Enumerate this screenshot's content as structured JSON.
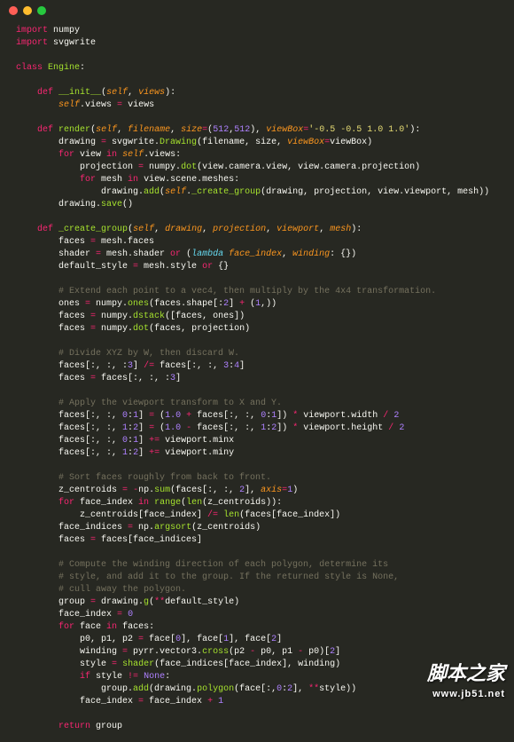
{
  "watermark": {
    "text": "脚本之家",
    "url": "www.jb51.net"
  },
  "code_lines": [
    [
      [
        "kw",
        "import"
      ],
      [
        "nm",
        " numpy"
      ]
    ],
    [
      [
        "kw",
        "import"
      ],
      [
        "nm",
        " svgwrite"
      ]
    ],
    [],
    [
      [
        "kw",
        "class"
      ],
      [
        "nm",
        " "
      ],
      [
        "cls",
        "Engine"
      ],
      [
        "nm",
        ":"
      ]
    ],
    [],
    [
      [
        "nm",
        "    "
      ],
      [
        "kw",
        "def"
      ],
      [
        "nm",
        " "
      ],
      [
        "fn",
        "__init__"
      ],
      [
        "nm",
        "("
      ],
      [
        "slf",
        "self"
      ],
      [
        "nm",
        ", "
      ],
      [
        "par",
        "views"
      ],
      [
        "nm",
        "):"
      ]
    ],
    [
      [
        "nm",
        "        "
      ],
      [
        "slf",
        "self"
      ],
      [
        "nm",
        ".views "
      ],
      [
        "op",
        "="
      ],
      [
        "nm",
        " views"
      ]
    ],
    [],
    [
      [
        "nm",
        "    "
      ],
      [
        "kw",
        "def"
      ],
      [
        "nm",
        " "
      ],
      [
        "fn",
        "render"
      ],
      [
        "nm",
        "("
      ],
      [
        "slf",
        "self"
      ],
      [
        "nm",
        ", "
      ],
      [
        "par",
        "filename"
      ],
      [
        "nm",
        ", "
      ],
      [
        "par",
        "size"
      ],
      [
        "op",
        "="
      ],
      [
        "nm",
        "("
      ],
      [
        "num",
        "512"
      ],
      [
        "nm",
        ","
      ],
      [
        "num",
        "512"
      ],
      [
        "nm",
        "), "
      ],
      [
        "par",
        "viewBox"
      ],
      [
        "op",
        "="
      ],
      [
        "str",
        "'-0.5 -0.5 1.0 1.0'"
      ],
      [
        "nm",
        "):"
      ]
    ],
    [
      [
        "nm",
        "        drawing "
      ],
      [
        "op",
        "="
      ],
      [
        "nm",
        " svgwrite."
      ],
      [
        "fn",
        "Drawing"
      ],
      [
        "nm",
        "(filename, size, "
      ],
      [
        "par",
        "viewBox"
      ],
      [
        "op",
        "="
      ],
      [
        "nm",
        "viewBox)"
      ]
    ],
    [
      [
        "nm",
        "        "
      ],
      [
        "kw",
        "for"
      ],
      [
        "nm",
        " view "
      ],
      [
        "kw",
        "in"
      ],
      [
        "nm",
        " "
      ],
      [
        "slf",
        "self"
      ],
      [
        "nm",
        ".views:"
      ]
    ],
    [
      [
        "nm",
        "            projection "
      ],
      [
        "op",
        "="
      ],
      [
        "nm",
        " numpy."
      ],
      [
        "fn",
        "dot"
      ],
      [
        "nm",
        "(view.camera.view, view.camera.projection)"
      ]
    ],
    [
      [
        "nm",
        "            "
      ],
      [
        "kw",
        "for"
      ],
      [
        "nm",
        " mesh "
      ],
      [
        "kw",
        "in"
      ],
      [
        "nm",
        " view.scene.meshes:"
      ]
    ],
    [
      [
        "nm",
        "                drawing."
      ],
      [
        "fn",
        "add"
      ],
      [
        "nm",
        "("
      ],
      [
        "slf",
        "self"
      ],
      [
        "nm",
        "."
      ],
      [
        "fn",
        "_create_group"
      ],
      [
        "nm",
        "(drawing, projection, view.viewport, mesh))"
      ]
    ],
    [
      [
        "nm",
        "        drawing."
      ],
      [
        "fn",
        "save"
      ],
      [
        "nm",
        "()"
      ]
    ],
    [],
    [
      [
        "nm",
        "    "
      ],
      [
        "kw",
        "def"
      ],
      [
        "nm",
        " "
      ],
      [
        "fn",
        "_create_group"
      ],
      [
        "nm",
        "("
      ],
      [
        "slf",
        "self"
      ],
      [
        "nm",
        ", "
      ],
      [
        "par",
        "drawing"
      ],
      [
        "nm",
        ", "
      ],
      [
        "par",
        "projection"
      ],
      [
        "nm",
        ", "
      ],
      [
        "par",
        "viewport"
      ],
      [
        "nm",
        ", "
      ],
      [
        "par",
        "mesh"
      ],
      [
        "nm",
        "):"
      ]
    ],
    [
      [
        "nm",
        "        faces "
      ],
      [
        "op",
        "="
      ],
      [
        "nm",
        " mesh.faces"
      ]
    ],
    [
      [
        "nm",
        "        shader "
      ],
      [
        "op",
        "="
      ],
      [
        "nm",
        " mesh.shader "
      ],
      [
        "kw",
        "or"
      ],
      [
        "nm",
        " ("
      ],
      [
        "kw2",
        "lambda"
      ],
      [
        "nm",
        " "
      ],
      [
        "par",
        "face_index"
      ],
      [
        "nm",
        ", "
      ],
      [
        "par",
        "winding"
      ],
      [
        "nm",
        ": {})"
      ]
    ],
    [
      [
        "nm",
        "        default_style "
      ],
      [
        "op",
        "="
      ],
      [
        "nm",
        " mesh.style "
      ],
      [
        "kw",
        "or"
      ],
      [
        "nm",
        " {}"
      ]
    ],
    [],
    [
      [
        "nm",
        "        "
      ],
      [
        "cm",
        "# Extend each point to a vec4, then multiply by the 4x4 transformation."
      ]
    ],
    [
      [
        "nm",
        "        ones "
      ],
      [
        "op",
        "="
      ],
      [
        "nm",
        " numpy."
      ],
      [
        "fn",
        "ones"
      ],
      [
        "nm",
        "(faces.shape[:"
      ],
      [
        "num",
        "2"
      ],
      [
        "nm",
        "] "
      ],
      [
        "op",
        "+"
      ],
      [
        "nm",
        " ("
      ],
      [
        "num",
        "1"
      ],
      [
        "nm",
        ",))"
      ]
    ],
    [
      [
        "nm",
        "        faces "
      ],
      [
        "op",
        "="
      ],
      [
        "nm",
        " numpy."
      ],
      [
        "fn",
        "dstack"
      ],
      [
        "nm",
        "([faces, ones])"
      ]
    ],
    [
      [
        "nm",
        "        faces "
      ],
      [
        "op",
        "="
      ],
      [
        "nm",
        " numpy."
      ],
      [
        "fn",
        "dot"
      ],
      [
        "nm",
        "(faces, projection)"
      ]
    ],
    [],
    [
      [
        "nm",
        "        "
      ],
      [
        "cm",
        "# Divide XYZ by W, then discard W."
      ]
    ],
    [
      [
        "nm",
        "        faces[:, :, :"
      ],
      [
        "num",
        "3"
      ],
      [
        "nm",
        "] "
      ],
      [
        "op",
        "/="
      ],
      [
        "nm",
        " faces[:, :, "
      ],
      [
        "num",
        "3"
      ],
      [
        "nm",
        ":"
      ],
      [
        "num",
        "4"
      ],
      [
        "nm",
        "]"
      ]
    ],
    [
      [
        "nm",
        "        faces "
      ],
      [
        "op",
        "="
      ],
      [
        "nm",
        " faces[:, :, :"
      ],
      [
        "num",
        "3"
      ],
      [
        "nm",
        "]"
      ]
    ],
    [],
    [
      [
        "nm",
        "        "
      ],
      [
        "cm",
        "# Apply the viewport transform to X and Y."
      ]
    ],
    [
      [
        "nm",
        "        faces[:, :, "
      ],
      [
        "num",
        "0"
      ],
      [
        "nm",
        ":"
      ],
      [
        "num",
        "1"
      ],
      [
        "nm",
        "] "
      ],
      [
        "op",
        "="
      ],
      [
        "nm",
        " ("
      ],
      [
        "num",
        "1.0"
      ],
      [
        "nm",
        " "
      ],
      [
        "op",
        "+"
      ],
      [
        "nm",
        " faces[:, :, "
      ],
      [
        "num",
        "0"
      ],
      [
        "nm",
        ":"
      ],
      [
        "num",
        "1"
      ],
      [
        "nm",
        "]) "
      ],
      [
        "op",
        "*"
      ],
      [
        "nm",
        " viewport.width "
      ],
      [
        "op",
        "/"
      ],
      [
        "nm",
        " "
      ],
      [
        "num",
        "2"
      ]
    ],
    [
      [
        "nm",
        "        faces[:, :, "
      ],
      [
        "num",
        "1"
      ],
      [
        "nm",
        ":"
      ],
      [
        "num",
        "2"
      ],
      [
        "nm",
        "] "
      ],
      [
        "op",
        "="
      ],
      [
        "nm",
        " ("
      ],
      [
        "num",
        "1.0"
      ],
      [
        "nm",
        " "
      ],
      [
        "op",
        "-"
      ],
      [
        "nm",
        " faces[:, :, "
      ],
      [
        "num",
        "1"
      ],
      [
        "nm",
        ":"
      ],
      [
        "num",
        "2"
      ],
      [
        "nm",
        "]) "
      ],
      [
        "op",
        "*"
      ],
      [
        "nm",
        " viewport.height "
      ],
      [
        "op",
        "/"
      ],
      [
        "nm",
        " "
      ],
      [
        "num",
        "2"
      ]
    ],
    [
      [
        "nm",
        "        faces[:, :, "
      ],
      [
        "num",
        "0"
      ],
      [
        "nm",
        ":"
      ],
      [
        "num",
        "1"
      ],
      [
        "nm",
        "] "
      ],
      [
        "op",
        "+="
      ],
      [
        "nm",
        " viewport.minx"
      ]
    ],
    [
      [
        "nm",
        "        faces[:, :, "
      ],
      [
        "num",
        "1"
      ],
      [
        "nm",
        ":"
      ],
      [
        "num",
        "2"
      ],
      [
        "nm",
        "] "
      ],
      [
        "op",
        "+="
      ],
      [
        "nm",
        " viewport.miny"
      ]
    ],
    [],
    [
      [
        "nm",
        "        "
      ],
      [
        "cm",
        "# Sort faces roughly from back to front."
      ]
    ],
    [
      [
        "nm",
        "        z_centroids "
      ],
      [
        "op",
        "="
      ],
      [
        "nm",
        " "
      ],
      [
        "op",
        "-"
      ],
      [
        "nm",
        "np."
      ],
      [
        "fn",
        "sum"
      ],
      [
        "nm",
        "(faces[:, :, "
      ],
      [
        "num",
        "2"
      ],
      [
        "nm",
        "], "
      ],
      [
        "par",
        "axis"
      ],
      [
        "op",
        "="
      ],
      [
        "num",
        "1"
      ],
      [
        "nm",
        ")"
      ]
    ],
    [
      [
        "nm",
        "        "
      ],
      [
        "kw",
        "for"
      ],
      [
        "nm",
        " face_index "
      ],
      [
        "kw",
        "in"
      ],
      [
        "nm",
        " "
      ],
      [
        "fn",
        "range"
      ],
      [
        "nm",
        "("
      ],
      [
        "fn",
        "len"
      ],
      [
        "nm",
        "(z_centroids)):"
      ]
    ],
    [
      [
        "nm",
        "            z_centroids[face_index] "
      ],
      [
        "op",
        "/="
      ],
      [
        "nm",
        " "
      ],
      [
        "fn",
        "len"
      ],
      [
        "nm",
        "(faces[face_index])"
      ]
    ],
    [
      [
        "nm",
        "        face_indices "
      ],
      [
        "op",
        "="
      ],
      [
        "nm",
        " np."
      ],
      [
        "fn",
        "argsort"
      ],
      [
        "nm",
        "(z_centroids)"
      ]
    ],
    [
      [
        "nm",
        "        faces "
      ],
      [
        "op",
        "="
      ],
      [
        "nm",
        " faces[face_indices]"
      ]
    ],
    [],
    [
      [
        "nm",
        "        "
      ],
      [
        "cm",
        "# Compute the winding direction of each polygon, determine its"
      ]
    ],
    [
      [
        "nm",
        "        "
      ],
      [
        "cm",
        "# style, and add it to the group. If the returned style is None,"
      ]
    ],
    [
      [
        "nm",
        "        "
      ],
      [
        "cm",
        "# cull away the polygon."
      ]
    ],
    [
      [
        "nm",
        "        group "
      ],
      [
        "op",
        "="
      ],
      [
        "nm",
        " drawing."
      ],
      [
        "fn",
        "g"
      ],
      [
        "nm",
        "("
      ],
      [
        "op",
        "**"
      ],
      [
        "nm",
        "default_style)"
      ]
    ],
    [
      [
        "nm",
        "        face_index "
      ],
      [
        "op",
        "="
      ],
      [
        "nm",
        " "
      ],
      [
        "num",
        "0"
      ]
    ],
    [
      [
        "nm",
        "        "
      ],
      [
        "kw",
        "for"
      ],
      [
        "nm",
        " face "
      ],
      [
        "kw",
        "in"
      ],
      [
        "nm",
        " faces:"
      ]
    ],
    [
      [
        "nm",
        "            p0, p1, p2 "
      ],
      [
        "op",
        "="
      ],
      [
        "nm",
        " face["
      ],
      [
        "num",
        "0"
      ],
      [
        "nm",
        "], face["
      ],
      [
        "num",
        "1"
      ],
      [
        "nm",
        "], face["
      ],
      [
        "num",
        "2"
      ],
      [
        "nm",
        "]"
      ]
    ],
    [
      [
        "nm",
        "            winding "
      ],
      [
        "op",
        "="
      ],
      [
        "nm",
        " pyrr.vector3."
      ],
      [
        "fn",
        "cross"
      ],
      [
        "nm",
        "(p2 "
      ],
      [
        "op",
        "-"
      ],
      [
        "nm",
        " p0, p1 "
      ],
      [
        "op",
        "-"
      ],
      [
        "nm",
        " p0)["
      ],
      [
        "num",
        "2"
      ],
      [
        "nm",
        "]"
      ]
    ],
    [
      [
        "nm",
        "            style "
      ],
      [
        "op",
        "="
      ],
      [
        "nm",
        " "
      ],
      [
        "fn",
        "shader"
      ],
      [
        "nm",
        "(face_indices[face_index], winding)"
      ]
    ],
    [
      [
        "nm",
        "            "
      ],
      [
        "kw",
        "if"
      ],
      [
        "nm",
        " style "
      ],
      [
        "op",
        "!="
      ],
      [
        "nm",
        " "
      ],
      [
        "num",
        "None"
      ],
      [
        "nm",
        ":"
      ]
    ],
    [
      [
        "nm",
        "                group."
      ],
      [
        "fn",
        "add"
      ],
      [
        "nm",
        "(drawing."
      ],
      [
        "fn",
        "polygon"
      ],
      [
        "nm",
        "(face[:,"
      ],
      [
        "num",
        "0"
      ],
      [
        "nm",
        ":"
      ],
      [
        "num",
        "2"
      ],
      [
        "nm",
        "], "
      ],
      [
        "op",
        "**"
      ],
      [
        "nm",
        "style))"
      ]
    ],
    [
      [
        "nm",
        "            face_index "
      ],
      [
        "op",
        "="
      ],
      [
        "nm",
        " face_index "
      ],
      [
        "op",
        "+"
      ],
      [
        "nm",
        " "
      ],
      [
        "num",
        "1"
      ]
    ],
    [],
    [
      [
        "nm",
        "        "
      ],
      [
        "kw",
        "return"
      ],
      [
        "nm",
        " group"
      ]
    ]
  ]
}
